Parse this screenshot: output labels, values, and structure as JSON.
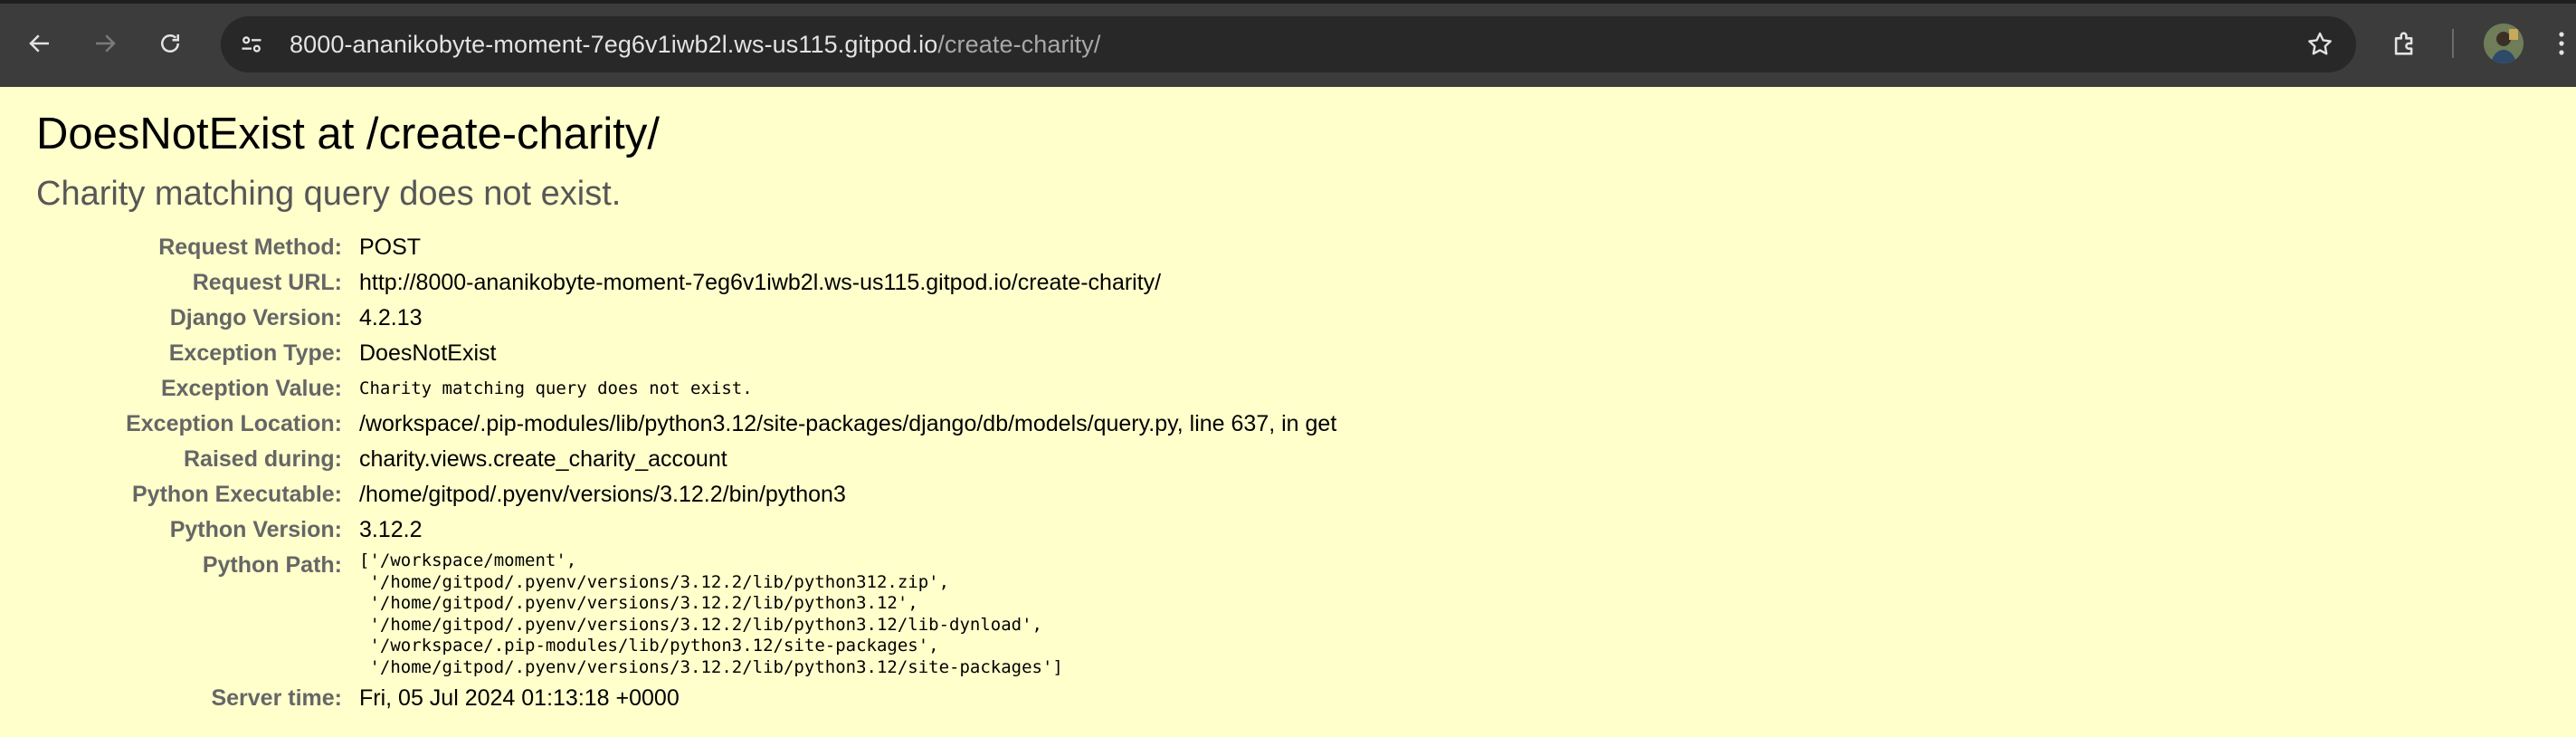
{
  "browser": {
    "url_host": "8000-ananikobyte-moment-7eg6v1iwb2l.ws-us115.gitpod.io",
    "url_path": "/create-charity/",
    "icons": [
      "back-arrow-icon",
      "forward-arrow-icon",
      "reload-icon",
      "site-info-icon",
      "bookmark-star-icon",
      "extensions-icon",
      "profile-avatar",
      "more-menu-icon"
    ]
  },
  "error": {
    "title": "DoesNotExist at /create-charity/",
    "message": "Charity matching query does not exist."
  },
  "meta": {
    "request_method": {
      "label": "Request Method:",
      "value": "POST"
    },
    "request_url": {
      "label": "Request URL:",
      "value": "http://8000-ananikobyte-moment-7eg6v1iwb2l.ws-us115.gitpod.io/create-charity/"
    },
    "django_version": {
      "label": "Django Version:",
      "value": "4.2.13"
    },
    "exception_type": {
      "label": "Exception Type:",
      "value": "DoesNotExist"
    },
    "exception_value": {
      "label": "Exception Value:",
      "value": "Charity matching query does not exist."
    },
    "exception_location": {
      "label": "Exception Location:",
      "value": "/workspace/.pip-modules/lib/python3.12/site-packages/django/db/models/query.py, line 637, in get"
    },
    "raised_during": {
      "label": "Raised during:",
      "value": "charity.views.create_charity_account"
    },
    "python_executable": {
      "label": "Python Executable:",
      "value": "/home/gitpod/.pyenv/versions/3.12.2/bin/python3"
    },
    "python_version": {
      "label": "Python Version:",
      "value": "3.12.2"
    },
    "python_path": {
      "label": "Python Path:",
      "value": "['/workspace/moment',\n '/home/gitpod/.pyenv/versions/3.12.2/lib/python312.zip',\n '/home/gitpod/.pyenv/versions/3.12.2/lib/python3.12',\n '/home/gitpod/.pyenv/versions/3.12.2/lib/python3.12/lib-dynload',\n '/workspace/.pip-modules/lib/python3.12/site-packages',\n '/home/gitpod/.pyenv/versions/3.12.2/lib/python3.12/site-packages']"
    },
    "server_time": {
      "label": "Server time:",
      "value": "Fri, 05 Jul 2024 01:13:18 +0000"
    }
  }
}
